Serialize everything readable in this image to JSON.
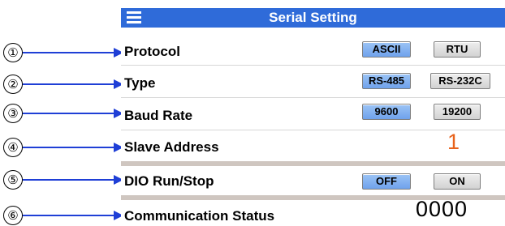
{
  "header": {
    "title": "Serial Setting",
    "menu_icon": "hamburger-menu-icon",
    "color": "#2f6bd9"
  },
  "callouts": [
    "①",
    "②",
    "③",
    "④",
    "⑤",
    "⑥"
  ],
  "rows": {
    "protocol": {
      "label": "Protocol",
      "options": [
        "ASCII",
        "RTU"
      ],
      "selected": "ASCII"
    },
    "type": {
      "label": "Type",
      "options": [
        "RS-485",
        "RS-232C"
      ],
      "selected": "RS-485"
    },
    "baud": {
      "label": "Baud Rate",
      "options": [
        "9600",
        "19200"
      ],
      "selected": "9600"
    },
    "slave": {
      "label": "Slave Address",
      "value": "1"
    },
    "dio": {
      "label": "DIO Run/Stop",
      "options": [
        "OFF",
        "ON"
      ],
      "selected": "OFF"
    },
    "comm": {
      "label": "Communication Status",
      "value": "0000"
    }
  },
  "colors": {
    "selected_button": "#7aa9ee",
    "unselected_button": "#dcdcdc",
    "address": "#e8631c",
    "arrow": "#1f3fd6"
  }
}
